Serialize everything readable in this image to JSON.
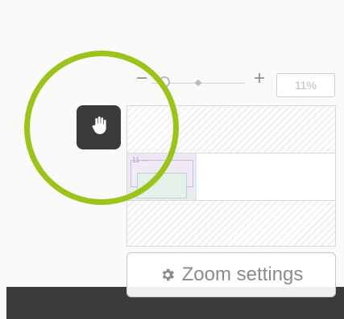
{
  "zoom": {
    "minus_label": "−",
    "plus_label": "+",
    "percent_label": "11%",
    "slider_fraction": 0.11
  },
  "minimap": {
    "thumbnail_text": "11 —"
  },
  "actions": {
    "zoom_settings_label": "Zoom settings"
  },
  "icons": {
    "pan": "hand-icon",
    "settings": "gear-icon"
  },
  "colors": {
    "highlight": "#9bc41a",
    "dark": "#3b3b3b"
  }
}
